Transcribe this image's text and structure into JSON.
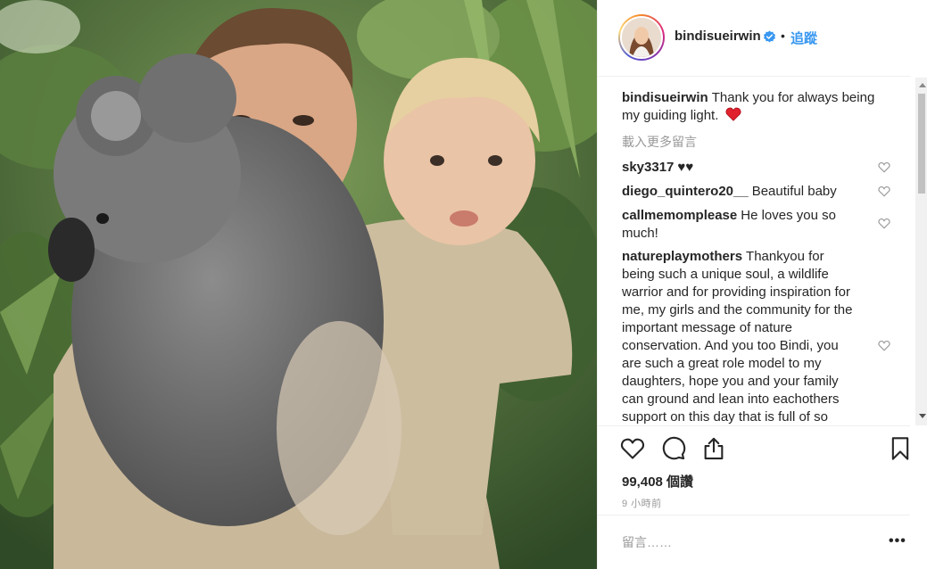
{
  "post": {
    "username": "bindisueirwin",
    "verified": true,
    "separator": "•",
    "follow_label": "追蹤",
    "caption": {
      "user": "bindisueirwin",
      "text": "Thank you for always being my guiding light.",
      "emoji": "heart-emoji"
    },
    "load_more_label": "載入更多留言",
    "comments": [
      {
        "user": "sky3317",
        "text": "♥♥"
      },
      {
        "user": "diego_quintero20__",
        "text": "Beautiful baby"
      },
      {
        "user": "callmemomplease",
        "text": "He loves you so much!"
      },
      {
        "user": "natureplaymothers",
        "text": "Thankyou for being such a unique soul, a wildlife warrior and for providing inspiration for me, my girls and the community for the important message of nature conservation. And you too Bindi, you are such a great role model to my daughters, hope you and your family can ground and lean into eachothers support on this day that is full of so"
      }
    ],
    "likes_label": "99,408 個讚",
    "time_label": "9 小時前",
    "comment_placeholder": "留言……",
    "more_options": "•••"
  },
  "icons": {
    "like": "heart-outline-icon",
    "comment": "speech-bubble-icon",
    "share": "share-upload-icon",
    "save": "bookmark-icon",
    "comment_like": "small-heart-icon",
    "verified": "verified-badge-icon"
  },
  "colors": {
    "accent": "#3897f0",
    "verified": "#3897f0",
    "muted": "#999999",
    "border": "#efefef",
    "heart_emoji": "#e0212e"
  }
}
